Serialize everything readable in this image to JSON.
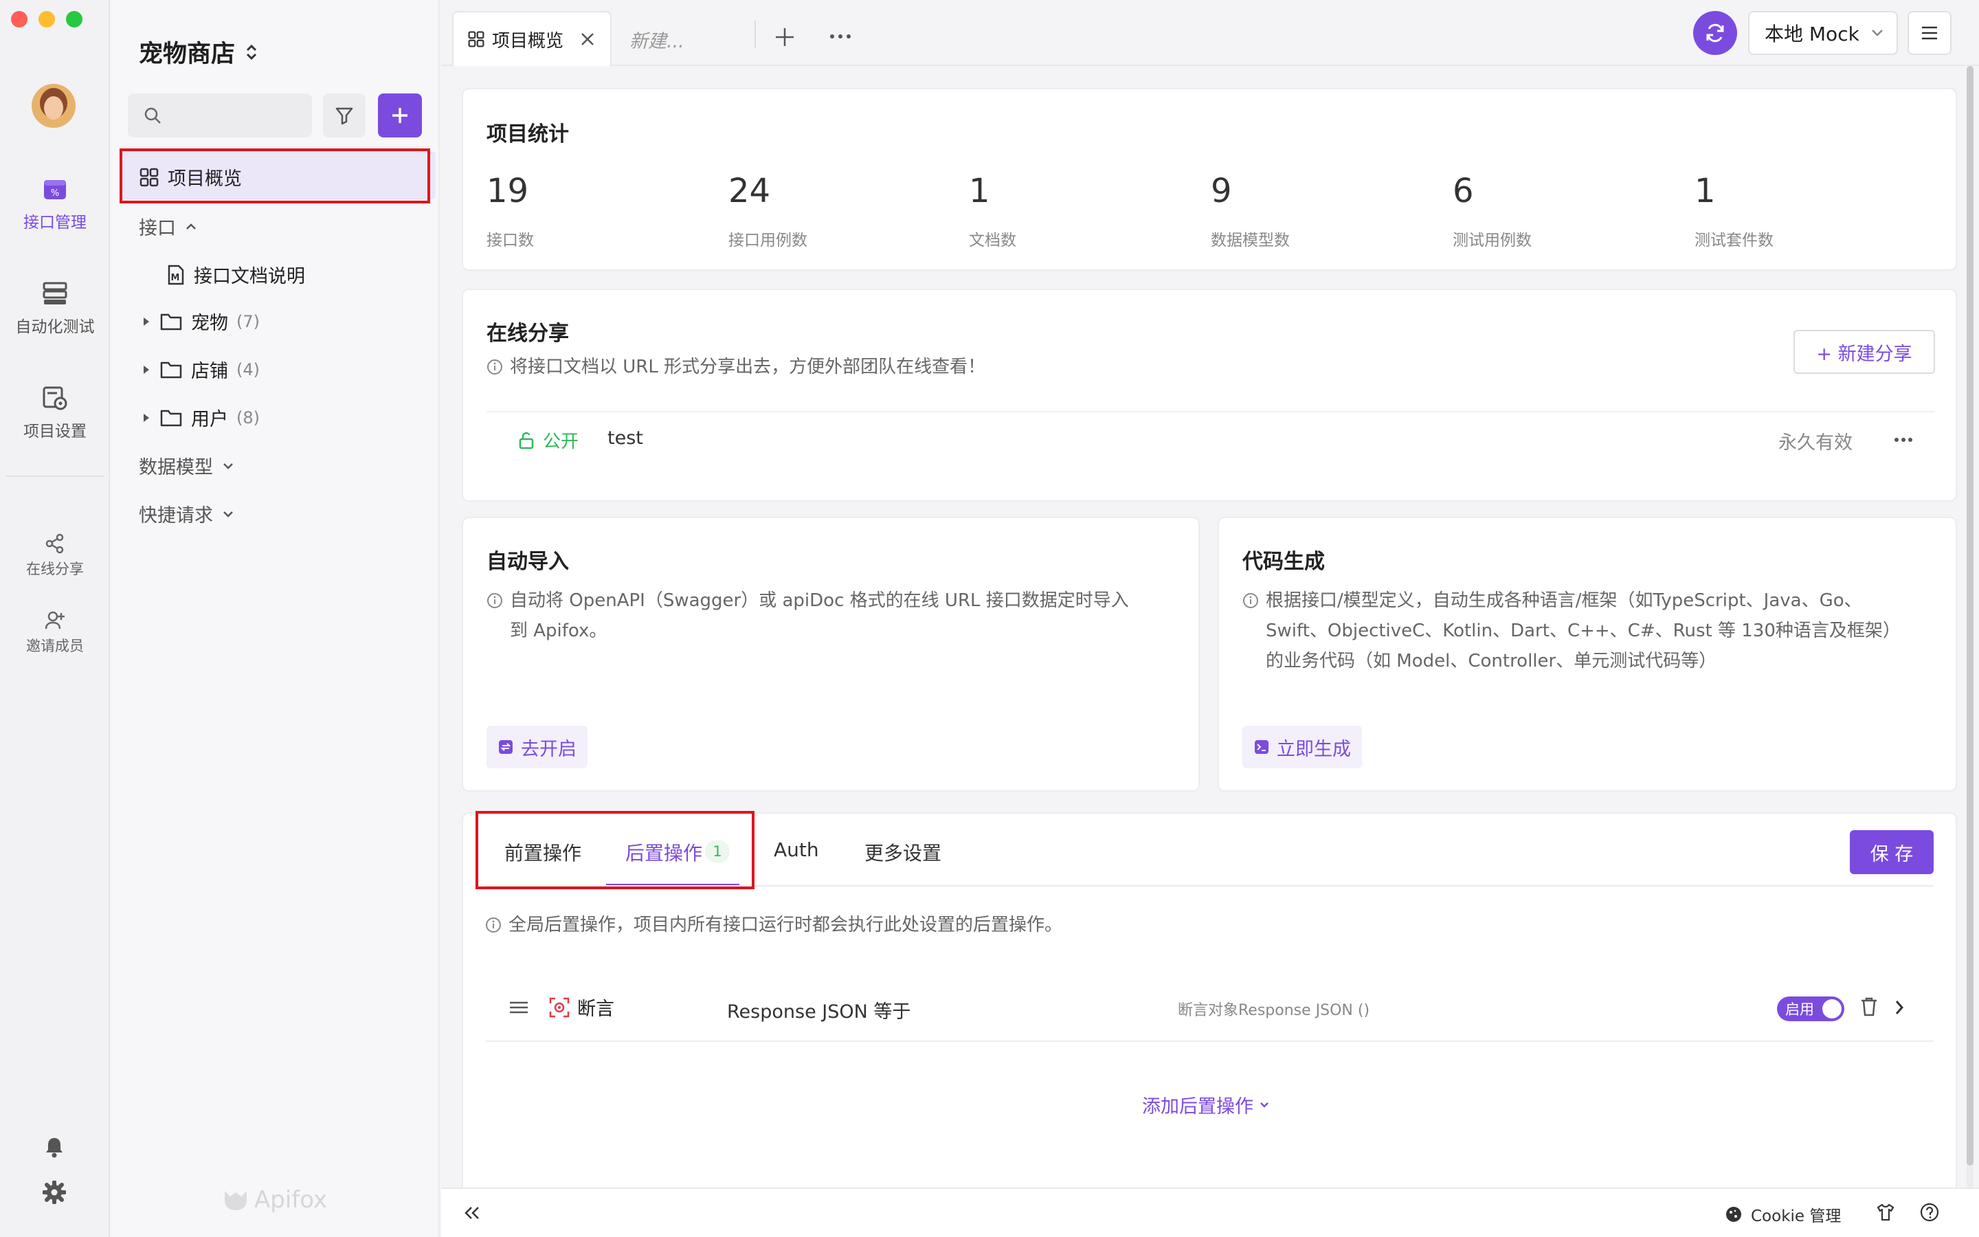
{
  "rail": {
    "items": [
      {
        "label": "接口管理",
        "icon": "api-icon"
      },
      {
        "label": "自动化测试",
        "icon": "stack-icon"
      },
      {
        "label": "项目设置",
        "icon": "project-settings-icon"
      },
      {
        "label": "在线分享",
        "icon": "share-icon"
      },
      {
        "label": "邀请成员",
        "icon": "invite-icon"
      }
    ]
  },
  "tree": {
    "project_name": "宠物商店",
    "selected": "项目概览",
    "api_section": "接口",
    "doc_item": "接口文档说明",
    "folders": [
      {
        "label": "宠物",
        "count": "(7)"
      },
      {
        "label": "店铺",
        "count": "(4)"
      },
      {
        "label": "用户",
        "count": "(8)"
      }
    ],
    "data_models": "数据模型",
    "quick_request": "快捷请求",
    "watermark": "Apifox"
  },
  "tabs": {
    "active": "项目概览",
    "new_placeholder": "新建...",
    "env": "本地 Mock"
  },
  "stats": {
    "title": "项目统计",
    "items": [
      {
        "value": "19",
        "label": "接口数"
      },
      {
        "value": "24",
        "label": "接口用例数"
      },
      {
        "value": "1",
        "label": "文档数"
      },
      {
        "value": "9",
        "label": "数据模型数"
      },
      {
        "value": "6",
        "label": "测试用例数"
      },
      {
        "value": "1",
        "label": "测试套件数"
      }
    ]
  },
  "share": {
    "title": "在线分享",
    "info": "将接口文档以 URL 形式分享出去，方便外部团队在线查看！",
    "new_button": "+ 新建分享",
    "row": {
      "visibility": "公开",
      "name": "test",
      "expiry": "永久有效"
    }
  },
  "auto_import": {
    "title": "自动导入",
    "info_line1": "自动将 OpenAPI（Swagger）或 apiDoc 格式的在线 URL 接口数据定时导入",
    "info_line2": "到 Apifox。",
    "button": "去开启"
  },
  "codegen": {
    "title": "代码生成",
    "info_line1": "根据接口/模型定义，自动生成各种语言/框架（如TypeScript、Java、Go、",
    "info_line2": "Swift、ObjectiveC、Kotlin、Dart、C++、C#、Rust 等 130种语言及框架）",
    "info_line3": "的业务代码（如 Model、Controller、单元测试代码等）",
    "button": "立即生成"
  },
  "settings": {
    "tabs": [
      "前置操作",
      "后置操作",
      "Auth",
      "更多设置"
    ],
    "badge": "1",
    "save": "保 存",
    "info": "全局后置操作，项目内所有接口运行时都会执行此处设置的后置操作。",
    "assertion": {
      "type": "断言",
      "desc": "Response JSON 等于",
      "target": "断言对象Response JSON ()",
      "toggle": "启用"
    },
    "add": "添加后置操作"
  },
  "footer": {
    "cookie": "Cookie 管理"
  },
  "colors": {
    "accent": "#7b4be0",
    "highlight": "#e0141e",
    "green": "#2fb85b"
  }
}
